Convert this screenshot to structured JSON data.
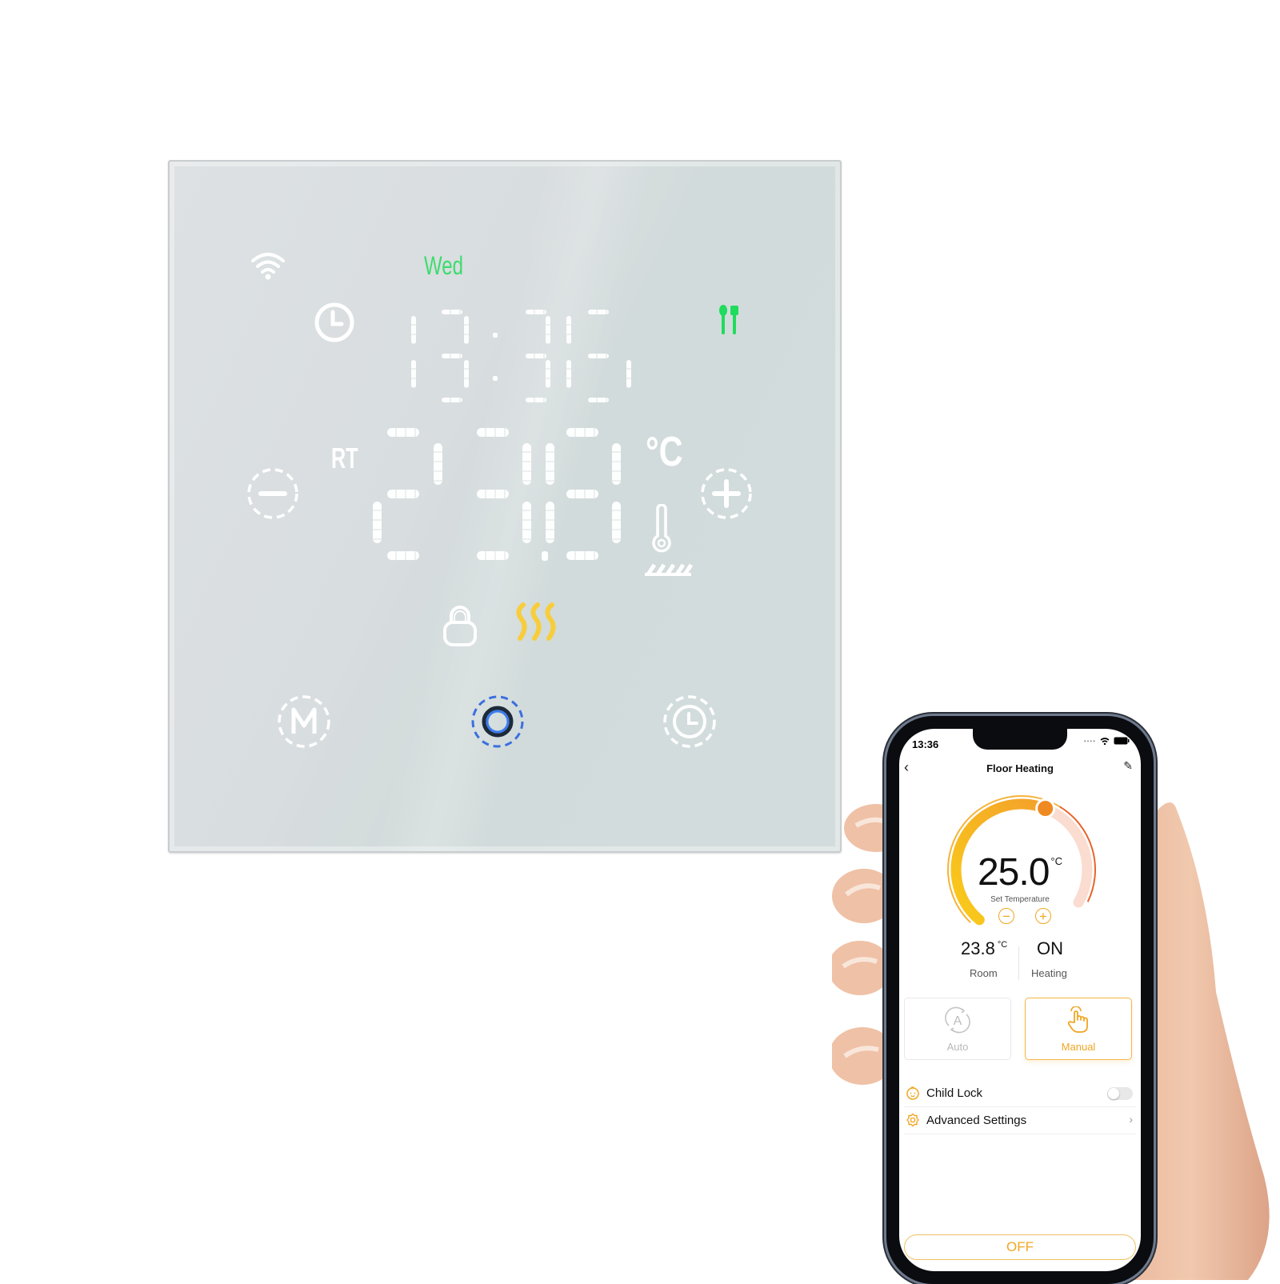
{
  "thermostat": {
    "day": "Wed",
    "clock": "13:36",
    "room_temp_label": "RT",
    "room_temp_display": "23.8",
    "temp_unit": "°C",
    "icons": {
      "wifi": "wifi-icon",
      "clock": "clock-icon",
      "eco": "fork-knife-icon",
      "minus": "minus-icon",
      "plus": "plus-icon",
      "sensor": "thermometer-icon",
      "floor": "floor-heating-icon",
      "lock": "lock-icon",
      "heat": "heating-waves-icon",
      "mode": "mode-m-icon",
      "power": "power-ring-icon",
      "schedule": "schedule-clock-icon"
    },
    "colors": {
      "day": "#3ddc6e",
      "eco": "#1fdc5c",
      "heat": "#f8cd3c",
      "power": "#3a6fe0",
      "segment": "#ffffff"
    }
  },
  "phone": {
    "status_bar": {
      "time": "13:36"
    },
    "nav": {
      "title": "Floor Heating",
      "back": "‹",
      "edit": "✎"
    },
    "dial": {
      "set_temperature": "25.0",
      "unit": "°C",
      "label": "Set Temperature",
      "minus": "−",
      "plus": "+",
      "fill_fraction": 0.62
    },
    "stats": {
      "room": {
        "value": "23.8",
        "unit": "°C",
        "label": "Room"
      },
      "heating": {
        "value": "ON",
        "label": "Heating"
      }
    },
    "modes": [
      {
        "label": "Auto",
        "selected": false
      },
      {
        "label": "Manual",
        "selected": true
      }
    ],
    "settings": [
      {
        "label": "Child Lock",
        "type": "toggle",
        "value": false
      },
      {
        "label": "Advanced Settings",
        "type": "link"
      }
    ],
    "power_button": "OFF",
    "colors": {
      "accent": "#f0a623",
      "knob": "#ef8a22",
      "arc_light": "#fadcd0",
      "arc_outer": "#e8642a"
    }
  }
}
